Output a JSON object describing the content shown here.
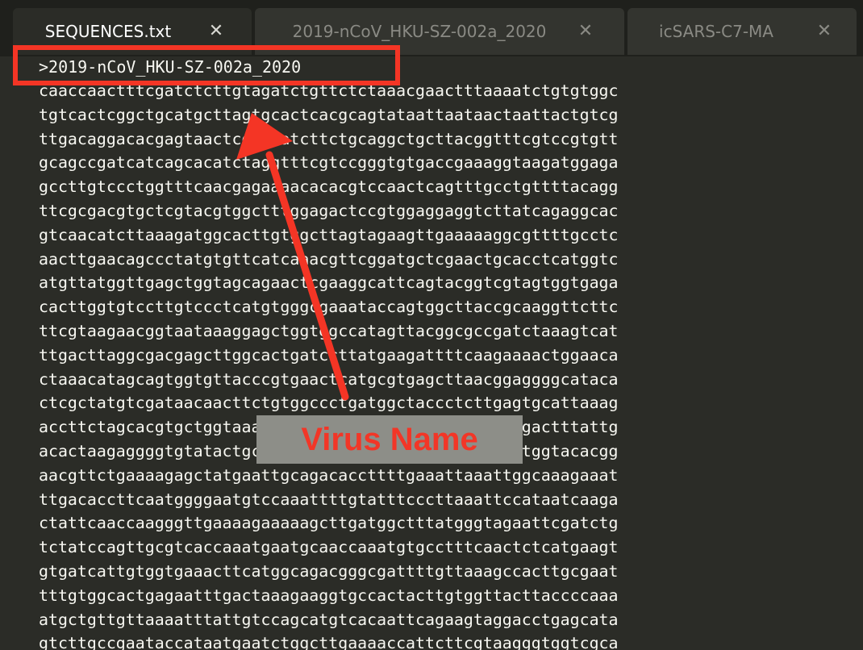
{
  "tabs": [
    {
      "label": "SEQUENCES.txt",
      "active": true,
      "close_icon": "close-icon"
    },
    {
      "label": "2019-nCoV_HKU-SZ-002a_2020",
      "active": false,
      "close_icon": "close-icon"
    },
    {
      "label": "icSARS-C7-MA",
      "active": false,
      "close_icon": "close-icon"
    }
  ],
  "editor": {
    "header_line": ">2019-nCoV_HKU-SZ-002a_2020",
    "sequence_lines": [
      "caaccaactttcgatctcttgtagatctgttctctaaacgaactttaaaatctgtgtggc",
      "tgtcactcggctgcatgcttagtgcactcacgcagtataattaataactaattactgtcg",
      "ttgacaggacacgagtaactcgtctatcttctgcaggctgcttacggtttcgtccgtgtt",
      "gcagccgatcatcagcacatctaggtttcgtccgggtgtgaccgaaaggtaagatggaga",
      "gccttgtccctggtttcaacgagaaaacacacgtccaactcagtttgcctgttttacagg",
      "ttcgcgacgtgctcgtacgtggctttggagactccgtggaggaggtcttatcagaggcac",
      "gtcaacatcttaaagatggcacttgtggcttagtagaagttgaaaaaggcgttttgcctc",
      "aacttgaacagccctatgtgttcatcaaacgttcggatgctcgaactgcacctcatggtc",
      "atgttatggttgagctggtagcagaactcgaaggcattcagtacggtcgtagtggtgaga",
      "cacttggtgtccttgtccctcatgtgggcgaaataccagtggcttaccgcaaggttcttc",
      "ttcgtaagaacggtaataaaggagctggtggccatagttacggcgccgatctaaagtcat",
      "ttgacttaggcgacgagcttggcactgatccttatgaagattttcaagaaaactggaaca",
      "ctaaacatagcagtggtgttacccgtgaactcatgcgtgagcttaacggaggggcataca",
      "ctcgctatgtcgataacaacttctgtggccctgatggctaccctcttgagtgcattaaag",
      "accttctagcacgtgctggtaaagcttcatgcactttgtccgaacaactggactttattg",
      "acactaagaggggtgtatactgctgccgtgaacatgagcatgaaattgcttggtacacgg",
      "aacgttctgaaaagagctatgaattgcagacaccttttgaaattaaattggcaaagaaat",
      "ttgacaccttcaatggggaatgtccaaattttgtatttcccttaaattccataatcaaga",
      "ctattcaaccaagggttgaaaagaaaaagcttgatggctttatgggtagaattcgatctg",
      "tctatccagttgcgtcaccaaatgaatgcaaccaaatgtgcctttcaactctcatgaagt",
      "gtgatcattgtggtgaaacttcatggcagacgggcgattttgttaaagccacttgcgaat",
      "tttgtggcactgagaatttgactaaagaaggtgccactacttgtggttacttaccccaaa",
      "atgctgttgttaaaatttattgtccagcatgtcacaattcagaagtaggacctgagcata",
      "gtcttgccgaataccataatgaatctggcttgaaaaccattcttcgtaagggtggtcgca"
    ]
  },
  "annotation": {
    "label": "Virus Name",
    "color": "#f43525",
    "callout_bg": "#8d8e88"
  }
}
